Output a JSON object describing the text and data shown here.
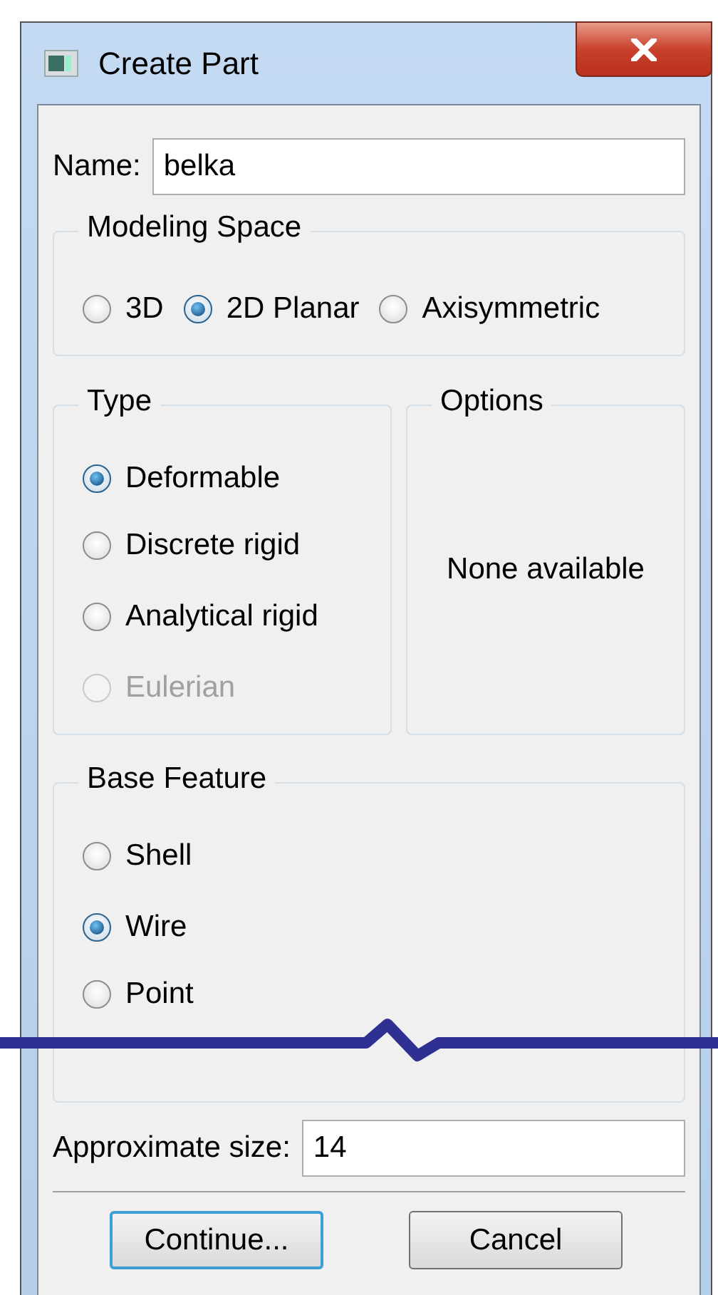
{
  "window": {
    "title": "Create Part"
  },
  "name_field": {
    "label": "Name:",
    "value": "belka"
  },
  "modeling_space": {
    "title": "Modeling Space",
    "options": [
      {
        "label": "3D",
        "selected": false,
        "disabled": false
      },
      {
        "label": "2D Planar",
        "selected": true,
        "disabled": false
      },
      {
        "label": "Axisymmetric",
        "selected": false,
        "disabled": false
      }
    ]
  },
  "type": {
    "title": "Type",
    "options": [
      {
        "label": "Deformable",
        "selected": true,
        "disabled": false
      },
      {
        "label": "Discrete rigid",
        "selected": false,
        "disabled": false
      },
      {
        "label": "Analytical rigid",
        "selected": false,
        "disabled": false
      },
      {
        "label": "Eulerian",
        "selected": false,
        "disabled": true
      }
    ]
  },
  "options": {
    "title": "Options",
    "message": "None available"
  },
  "base_feature": {
    "title": "Base Feature",
    "options": [
      {
        "label": "Shell",
        "selected": false,
        "disabled": false
      },
      {
        "label": "Wire",
        "selected": true,
        "disabled": false
      },
      {
        "label": "Point",
        "selected": false,
        "disabled": false
      }
    ]
  },
  "approximate_size": {
    "label": "Approximate size:",
    "value": "14"
  },
  "buttons": [
    {
      "label": "Continue...",
      "focused": true
    },
    {
      "label": "Cancel",
      "focused": false
    }
  ]
}
